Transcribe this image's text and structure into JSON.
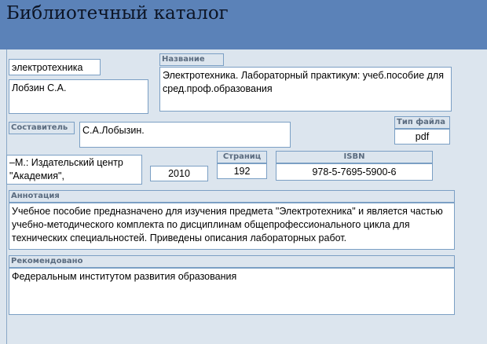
{
  "window": {
    "title": "Библиотечный каталог"
  },
  "form": {
    "category": "электротехника",
    "author": "Лобзин С.А.",
    "title_label": "Название",
    "title_value": "Электротехника. Лабораторный практикум: учеб.пособие для сред.проф.образования",
    "compiler_label": "Составитель",
    "compiler_value": "С.А.Лобызин.",
    "filetype_label": "Тип файла",
    "filetype_value": "pdf",
    "publisher": "–М.: Издательский центр \"Академия\",",
    "year": "2010",
    "pages_label": "Страниц",
    "pages_value": "192",
    "isbn_label": "ISBN",
    "isbn_value": "978-5-7695-5900-6",
    "annotation_label": "Аннотация",
    "annotation_value": "Учебное пособие предназначено для изучения предмета \"Электротехника\" и является частью учебно-методического  комплекта по дисциплинам общепрофессионального цикла для технических специальностей. Приведены описания лабораторных работ.",
    "recommended_label": "Рекомендовано",
    "recommended_value": "Федеральным институтом развития образования"
  }
}
